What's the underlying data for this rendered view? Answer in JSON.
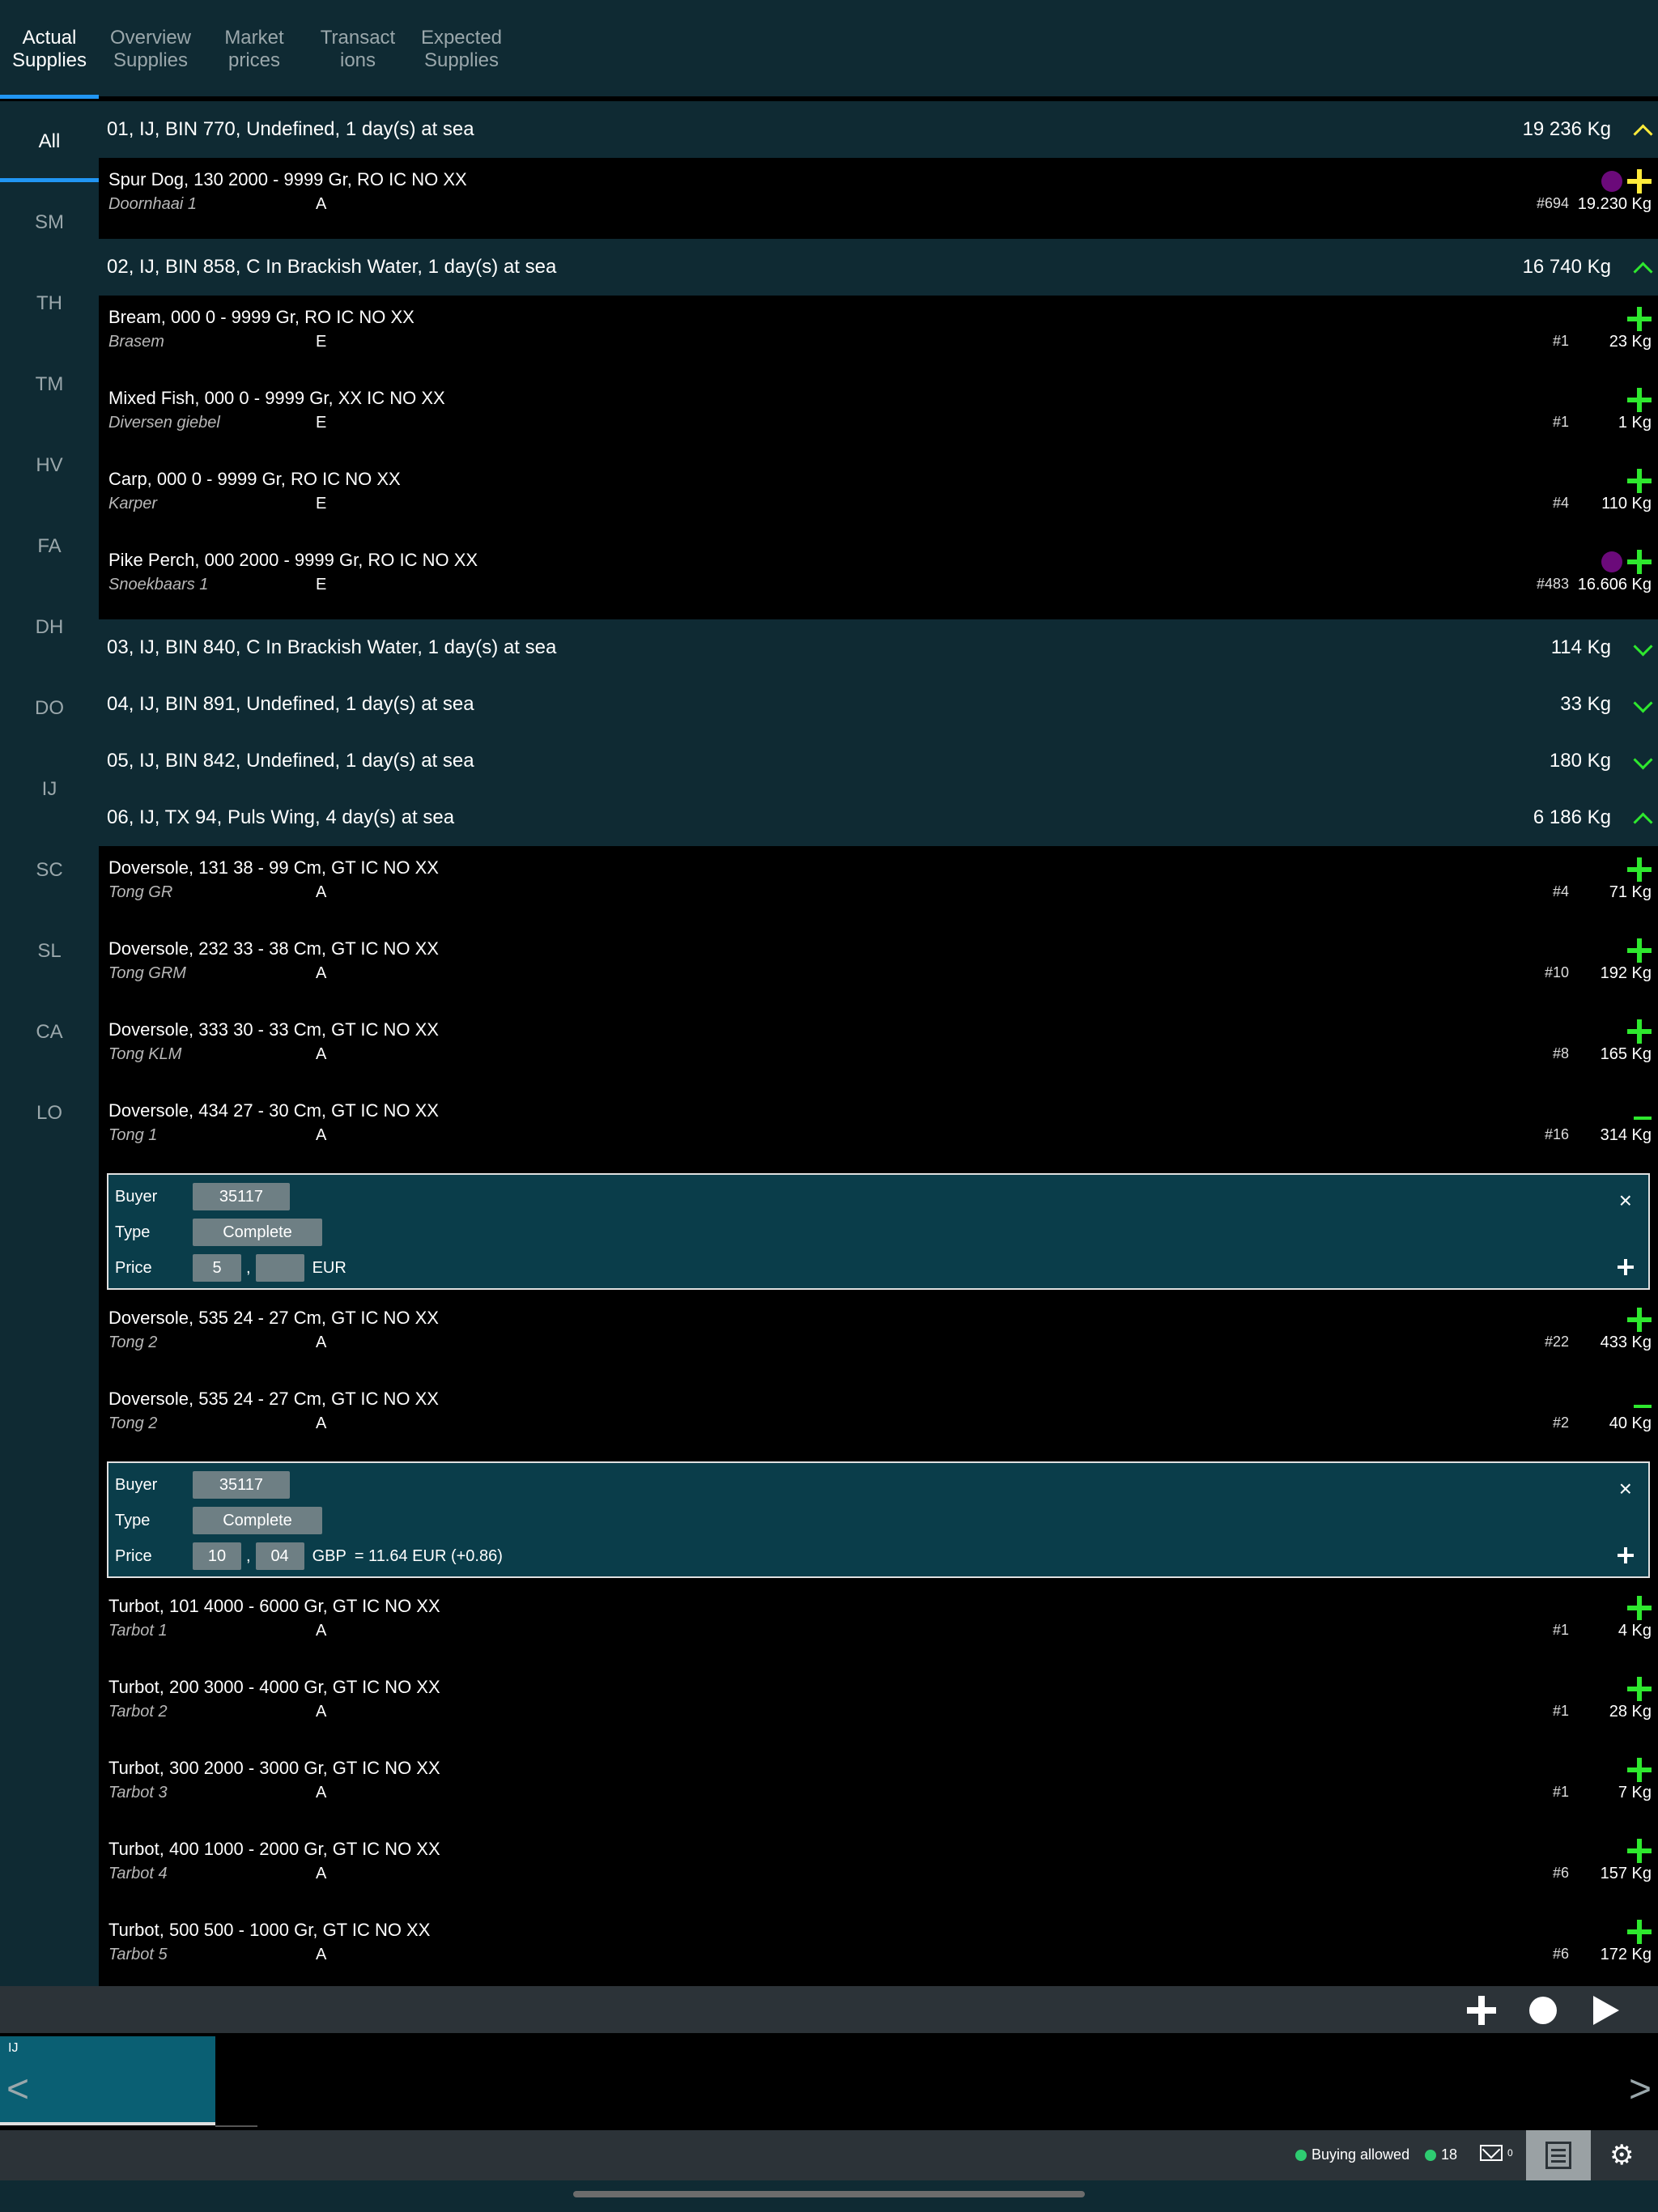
{
  "top_tabs": [
    {
      "line1": "Actual",
      "line2": "Supplies",
      "active": true
    },
    {
      "line1": "Overview",
      "line2": "Supplies",
      "active": false
    },
    {
      "line1": "Market",
      "line2": "prices",
      "active": false
    },
    {
      "line1": "Transact",
      "line2": "ions",
      "active": false
    },
    {
      "line1": "Expected",
      "line2": "Supplies",
      "active": false
    }
  ],
  "sidebar": [
    "All",
    "SM",
    "TH",
    "TM",
    "HV",
    "FA",
    "DH",
    "DO",
    "IJ",
    "SC",
    "SL",
    "CA",
    "LO"
  ],
  "groups": [
    {
      "title": "01, IJ, BIN 770, Undefined, 1 day(s) at sea",
      "total": "19 236 Kg",
      "expanded": true,
      "chevron_color": "yellow",
      "items": [
        {
          "title": "Spur Dog, 130 2000 - 9999 Gr, RO IC NO XX",
          "sub": "Doornhaai 1",
          "grade": "A",
          "lot": "#694",
          "kg": "19.230 Kg",
          "dot": true,
          "control": "plus-yellow"
        }
      ]
    },
    {
      "title": "02, IJ, BIN 858, C In Brackish Water, 1 day(s) at sea",
      "total": "16 740 Kg",
      "expanded": true,
      "chevron_color": "green",
      "items": [
        {
          "title": "Bream, 000 0 - 9999 Gr, RO IC NO XX",
          "sub": "Brasem",
          "grade": "E",
          "lot": "#1",
          "kg": "23 Kg",
          "dot": false,
          "control": "plus"
        },
        {
          "title": "Mixed Fish, 000 0 - 9999 Gr, XX IC NO XX",
          "sub": "Diversen  giebel",
          "grade": "E",
          "lot": "#1",
          "kg": "1 Kg",
          "dot": false,
          "control": "plus"
        },
        {
          "title": "Carp, 000 0 - 9999 Gr, RO IC NO XX",
          "sub": "Karper",
          "grade": "E",
          "lot": "#4",
          "kg": "110 Kg",
          "dot": false,
          "control": "plus"
        },
        {
          "title": "Pike Perch, 000 2000 - 9999 Gr, RO IC NO XX",
          "sub": "Snoekbaars 1",
          "grade": "E",
          "lot": "#483",
          "kg": "16.606 Kg",
          "dot": true,
          "control": "plus"
        }
      ]
    },
    {
      "title": "03, IJ, BIN 840, C In Brackish Water, 1 day(s) at sea",
      "total": "114 Kg",
      "expanded": false,
      "chevron_color": "green",
      "items": []
    },
    {
      "title": "04, IJ, BIN 891, Undefined, 1 day(s) at sea",
      "total": "33 Kg",
      "expanded": false,
      "chevron_color": "green",
      "items": []
    },
    {
      "title": "05, IJ, BIN 842, Undefined, 1 day(s) at sea",
      "total": "180 Kg",
      "expanded": false,
      "chevron_color": "green",
      "items": []
    },
    {
      "title": "06, IJ, TX 94, Puls Wing, 4 day(s) at sea",
      "total": "6 186 Kg",
      "expanded": true,
      "chevron_color": "green",
      "items": [
        {
          "title": "Doversole, 131 38 - 99 Cm, GT IC NO XX",
          "sub": "Tong GR",
          "grade": "A",
          "lot": "#4",
          "kg": "71 Kg",
          "dot": false,
          "control": "plus"
        },
        {
          "title": "Doversole, 232 33 - 38 Cm, GT IC NO XX",
          "sub": "Tong GRM",
          "grade": "A",
          "lot": "#10",
          "kg": "192 Kg",
          "dot": false,
          "control": "plus"
        },
        {
          "title": "Doversole, 333 30 - 33 Cm, GT IC NO XX",
          "sub": "Tong KLM",
          "grade": "A",
          "lot": "#8",
          "kg": "165 Kg",
          "dot": false,
          "control": "plus"
        },
        {
          "title": "Doversole, 434 27 - 30 Cm, GT IC NO XX",
          "sub": "Tong 1",
          "grade": "A",
          "lot": "#16",
          "kg": "314 Kg",
          "dot": false,
          "control": "minus",
          "bid": {
            "buyer_label": "Buyer",
            "buyer": "35117",
            "type_label": "Type",
            "type": "Complete",
            "price_label": "Price",
            "price_int": "5",
            "price_dec": "",
            "currency": "EUR",
            "conversion": ""
          }
        },
        {
          "title": "Doversole, 535 24 - 27 Cm, GT IC NO XX",
          "sub": "Tong 2",
          "grade": "A",
          "lot": "#22",
          "kg": "433 Kg",
          "dot": false,
          "control": "plus"
        },
        {
          "title": "Doversole, 535 24 - 27 Cm, GT IC NO XX",
          "sub": "Tong 2",
          "grade": "A",
          "lot": "#2",
          "kg": "40 Kg",
          "dot": false,
          "control": "minus",
          "bid": {
            "buyer_label": "Buyer",
            "buyer": "35117",
            "type_label": "Type",
            "type": "Complete",
            "price_label": "Price",
            "price_int": "10",
            "price_dec": "04",
            "currency": "GBP",
            "conversion": "= 11.64 EUR (+0.86)"
          }
        },
        {
          "title": "Turbot, 101 4000 - 6000 Gr, GT IC NO XX",
          "sub": "Tarbot 1",
          "grade": "A",
          "lot": "#1",
          "kg": "4 Kg",
          "dot": false,
          "control": "plus"
        },
        {
          "title": "Turbot, 200 3000 - 4000 Gr, GT IC NO XX",
          "sub": "Tarbot 2",
          "grade": "A",
          "lot": "#1",
          "kg": "28 Kg",
          "dot": false,
          "control": "plus"
        },
        {
          "title": "Turbot, 300 2000 - 3000 Gr, GT IC NO XX",
          "sub": "Tarbot 3",
          "grade": "A",
          "lot": "#1",
          "kg": "7 Kg",
          "dot": false,
          "control": "plus"
        },
        {
          "title": "Turbot, 400 1000 - 2000 Gr, GT IC NO XX",
          "sub": "Tarbot 4",
          "grade": "A",
          "lot": "#6",
          "kg": "157 Kg",
          "dot": false,
          "control": "plus"
        },
        {
          "title": "Turbot, 500 500 - 1000 Gr, GT IC NO XX",
          "sub": "Tarbot 5",
          "grade": "A",
          "lot": "#6",
          "kg": "172 Kg",
          "dot": false,
          "control": "plus"
        }
      ]
    }
  ],
  "strip": {
    "tile_label": "IJ",
    "prev": "<",
    "next": ">"
  },
  "status": {
    "buying": "Buying allowed",
    "count": "18",
    "mail_count": "0"
  },
  "colors": {
    "accent": "#2196f3",
    "header_bg": "#0f2a33",
    "panel_bg": "#0a3d4a",
    "green": "#2ee82e",
    "yellow": "#ffeb3b",
    "purple": "#6b0a7a"
  }
}
